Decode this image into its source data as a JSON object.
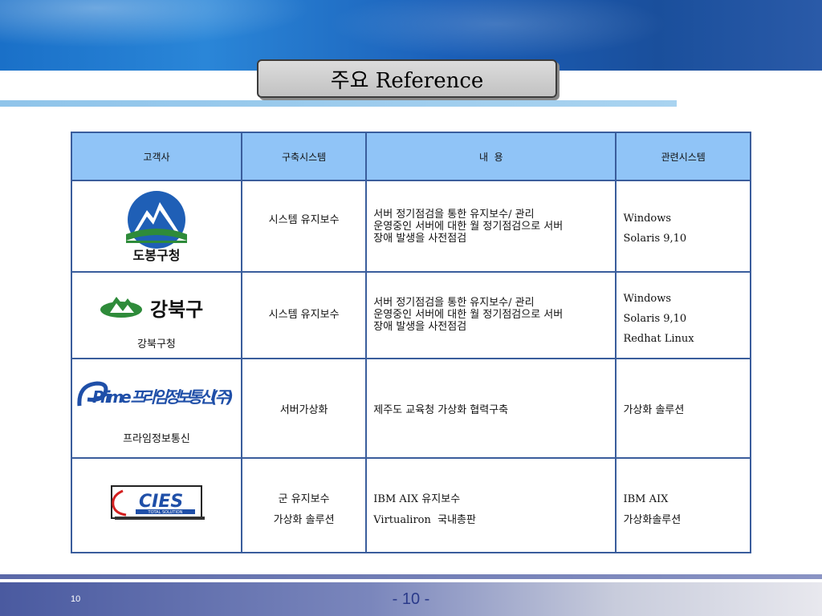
{
  "slide": {
    "title": "주요 Reference",
    "page_number_small": "10",
    "page_number_center": "- 10 -"
  },
  "table": {
    "headers": [
      "고객사",
      "구축시스템",
      "내  용",
      "관련시스템"
    ],
    "rows": [
      {
        "customer_logo": "dobong-logo",
        "customer_logo_text": "도봉구청",
        "customer_caption": "",
        "system": [
          "시스템 유지보수"
        ],
        "content": [
          "서버 정기점검을 통한 유지보수/ 관리",
          "운영중인 서버에 대한 월 정기점검으로 서버",
          "장애 발생을 사전점검"
        ],
        "related": [
          "Windows",
          "Solaris 9,10"
        ]
      },
      {
        "customer_logo": "gangbuk-logo",
        "customer_logo_text": "강북구",
        "customer_caption": "강북구청",
        "system": [
          "시스템 유지보수"
        ],
        "content": [
          "서버 정기점검을 통한 유지보수/ 관리",
          "운영중인 서버에 대한 월 정기점검으로 서버",
          "장애 발생을 사전점검"
        ],
        "related": [
          "Windows",
          "Solaris 9,10",
          "Redhat Linux"
        ]
      },
      {
        "customer_logo": "prime-logo",
        "customer_logo_text": "Prime 프라임정보통신(주)",
        "customer_caption": "프라임정보통신",
        "system": [
          "서버가상화"
        ],
        "content": [
          "제주도 교육청 가상화 협력구축"
        ],
        "related": [
          "가상화 솔루션"
        ]
      },
      {
        "customer_logo": "cies-logo",
        "customer_logo_text": "CIES",
        "customer_logo_subtext": "TOTAL SOLUTION",
        "customer_caption": "",
        "system": [
          "군 유지보수",
          "가상화 솔루션"
        ],
        "content": [
          "IBM AIX 유지보수",
          "Virtualiron  국내총판"
        ],
        "related": [
          "IBM AIX",
          "가상화솔루션"
        ]
      }
    ]
  },
  "colors": {
    "header_fill": "#90c4f7",
    "border": "#3a5d9c",
    "banner": "#1b5fb8",
    "footer": "#4a5aa0"
  }
}
